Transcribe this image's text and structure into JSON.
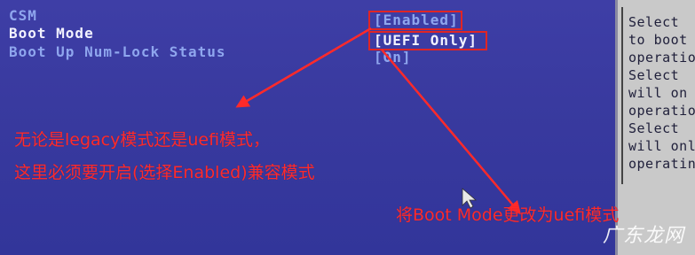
{
  "bios": {
    "settings": [
      {
        "label": "CSM",
        "value": "[Enabled]"
      },
      {
        "label": "Boot Mode",
        "value": "[UEFI Only]"
      },
      {
        "label": "Boot Up Num-Lock Status",
        "value": "[On]"
      }
    ],
    "help_text": [
      "Select",
      "to boot",
      "operatio",
      "Select",
      "will on",
      "operatio",
      "Select",
      "will onl",
      "operatin"
    ]
  },
  "annotations": {
    "line1": "无论是legacy模式还是uefi模式，",
    "line2": "这里必须要开启(选择Enabled)兼容模式",
    "line3": "将Boot Mode更改为uefi模式"
  },
  "watermark": "广东龙网",
  "colors": {
    "bios_bg": "#3a3aa2",
    "label_text": "#8fa6ee",
    "selected_text": "#f2f2ff",
    "help_bg": "#c9c9c9",
    "annotation": "#ff2a2a"
  }
}
